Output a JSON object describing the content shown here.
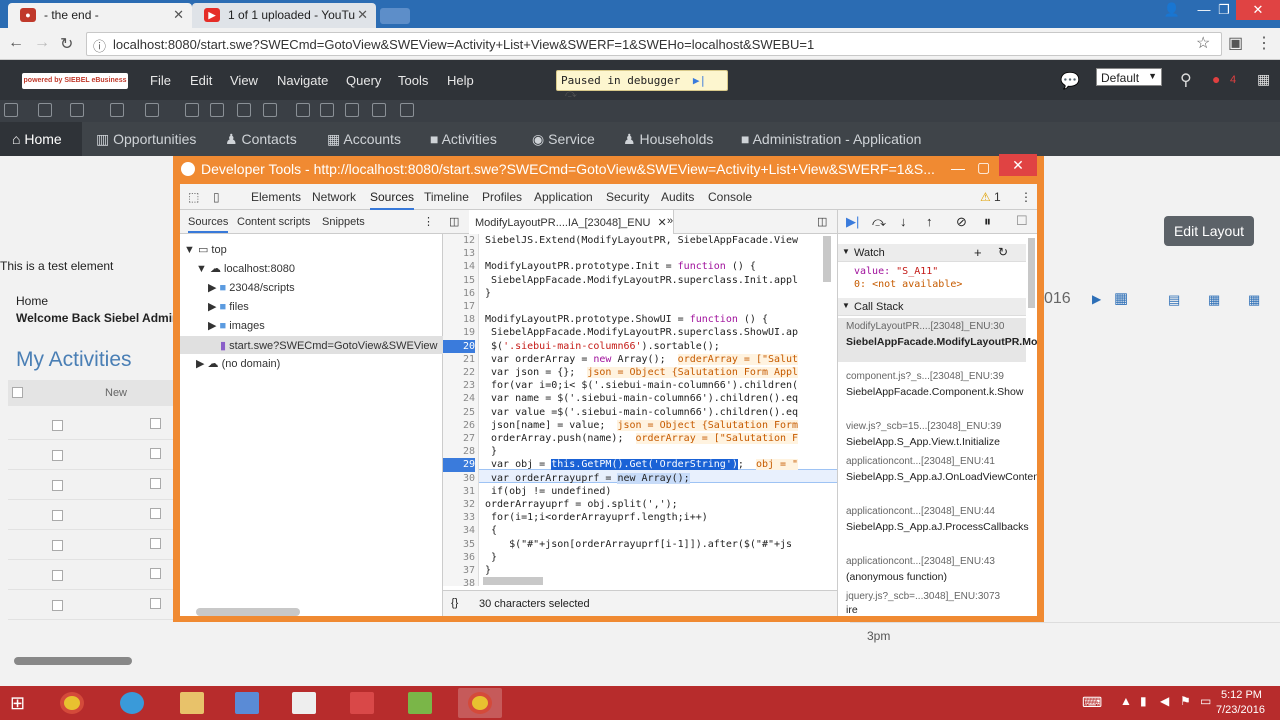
{
  "browser": {
    "tabs": [
      {
        "title": "- the end -",
        "icon": "siebel-icon"
      },
      {
        "title": "1 of 1 uploaded - YouTu",
        "icon": "youtube-icon"
      }
    ],
    "url": "localhost:8080/start.swe?SWECmd=GotoView&SWEView=Activity+List+View&SWERF=1&SWEHo=localhost&SWEBU=1"
  },
  "siebel": {
    "logo": "powered by SIEBEL eBusiness",
    "menu": [
      "File",
      "Edit",
      "View",
      "Navigate",
      "Query",
      "Tools",
      "Help"
    ],
    "debugger_status": "Paused in debugger",
    "layout_select": "Default",
    "notification_count": "4",
    "screen_tabs": [
      "Home",
      "Opportunities",
      "Contacts",
      "Accounts",
      "Activities",
      "Service",
      "Households",
      "Administration - Application"
    ],
    "test_element": "This is a test element",
    "breadcrumb": "Home",
    "welcome": "Welcome Back Siebel Admin",
    "applet_title": "My Activities",
    "col_new": "New",
    "edit_layout": "Edit Layout",
    "calendar_year_fragment": "016",
    "time_label": "3pm"
  },
  "devtools": {
    "title": "Developer Tools - http://localhost:8080/start.swe?SWECmd=GotoView&SWEView=Activity+List+View&SWERF=1&S...",
    "tabs": [
      "Elements",
      "Network",
      "Sources",
      "Timeline",
      "Profiles",
      "Application",
      "Security",
      "Audits",
      "Console"
    ],
    "warning_count": "1",
    "nav_subtabs": [
      "Sources",
      "Content scripts",
      "Snippets"
    ],
    "tree": {
      "top": "top",
      "host": "localhost:8080",
      "folders": [
        "23048/scripts",
        "files",
        "images"
      ],
      "file": "start.swe?SWECmd=GotoView&SWEView",
      "no_domain": "(no domain)"
    },
    "editor_tab": "ModifyLayoutPR....IA_[23048]_ENU",
    "line_numbers": [
      "12",
      "13",
      "14",
      "15",
      "16",
      "17",
      "18",
      "19",
      "20",
      "21",
      "22",
      "23",
      "24",
      "25",
      "26",
      "27",
      "28",
      "29",
      "30",
      "31",
      "32",
      "33",
      "34",
      "35",
      "36",
      "37",
      "38"
    ],
    "code": {
      "l12": "SiebelJS.Extend(ModifyLayoutPR, SiebelAppFacade.View",
      "l14a": "ModifyLayoutPR.prototype.Init = ",
      "l14kw": "function",
      "l14b": " () {",
      "l15": " SiebelAppFacade.ModifyLayoutPR.superclass.Init.appl",
      "l16": "}",
      "l18a": "ModifyLayoutPR.prototype.ShowUI = ",
      "l18kw": "function",
      "l18b": " () {",
      "l19": " SiebelAppFacade.ModifyLayoutPR.superclass.ShowUI.ap",
      "l20a": " $(",
      "l20s": "'.siebui-main-column66'",
      "l20b": ").sortable();",
      "l21a": " var orderArray = ",
      "l21kw": "new",
      "l21b": " Array();  ",
      "l21i": "orderArray = [\"Salut",
      "l22a": " var json = {};  ",
      "l22i": "json = Object {Salutation Form Appl",
      "l23": " for(var i=0;i< $('.siebui-main-column66').children(",
      "l24": " var name = $('.siebui-main-column66').children().eq",
      "l25": " var value =$('.siebui-main-column66').children().eq",
      "l26a": " json[name] = value;  ",
      "l26i": "json = Object {Salutation Form",
      "l27a": " orderArray.push(name);  ",
      "l27i": "orderArray = [\"Salutation F",
      "l28": " }",
      "l29a": " var obj = ",
      "l29sel": "this.GetPM().Get('OrderString')",
      "l29b": ";  ",
      "l29i": "obj = \"",
      "l30a": " var orderArrayuprf = ",
      "l30sel": "new Array();",
      "l31": " if(obj != undefined)",
      "l32": "orderArrayuprf = obj.split(',');",
      "l33": " for(i=1;i<orderArrayuprf.length;i++)",
      "l34": " {",
      "l35": "    $(\"#\"+json[orderArrayuprf[i-1]]).after($(\"#\"+js",
      "l36": " }",
      "l37": "}"
    },
    "status": "30 characters selected",
    "watch": {
      "header": "Watch",
      "value_label": "value:",
      "value": "\"S_A11\"",
      "zero_label": "0:",
      "zero_value": "<not available>"
    },
    "call_stack": {
      "header": "Call Stack",
      "frames": [
        {
          "file": "ModifyLayoutPR....[23048]_ENU:30",
          "fn": "SiebelAppFacade.ModifyLayoutPR.ModifyLayoutPR.ShowUI"
        },
        {
          "file": "component.js?_s...[23048]_ENU:39",
          "fn": "SiebelAppFacade.Component.k.Show"
        },
        {
          "file": "view.js?_scb=15...[23048]_ENU:39",
          "fn": "SiebelApp.S_App.View.t.Initialize"
        },
        {
          "file": "applicationcont...[23048]_ENU:41",
          "fn": "SiebelApp.S_App.aJ.OnLoadViewContent"
        },
        {
          "file": "applicationcont...[23048]_ENU:44",
          "fn": "SiebelApp.S_App.aJ.ProcessCallbacks"
        },
        {
          "file": "applicationcont...[23048]_ENU:43",
          "fn": "(anonymous function)"
        },
        {
          "file": "jquery.js?_scb=...3048]_ENU:3073",
          "fn": "ire"
        }
      ]
    }
  },
  "taskbar": {
    "time": "5:12 PM",
    "date": "7/23/2016"
  },
  "colors": {
    "devtools_frame": "#f08a32",
    "browser_tabstrip": "#2b6cb3",
    "taskbar": "#b72c2c",
    "siebel_menu": "#2f3338"
  }
}
